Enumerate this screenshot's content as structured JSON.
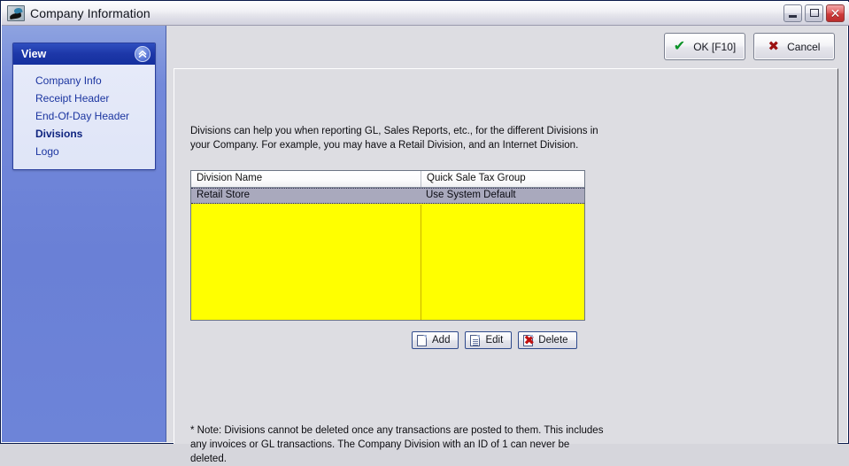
{
  "window": {
    "title": "Company Information",
    "icon": "app-swoosh-icon",
    "controls": {
      "minimize": "Minimize",
      "maximize": "Maximize",
      "close": "Close"
    }
  },
  "sidebar": {
    "header": {
      "title": "View",
      "collapse_icon": "chevron-double-up-icon"
    },
    "items": [
      {
        "label": "Company Info",
        "active": false
      },
      {
        "label": "Receipt Header",
        "active": false
      },
      {
        "label": "End-Of-Day Header",
        "active": false
      },
      {
        "label": "Divisions",
        "active": true
      },
      {
        "label": "Logo",
        "active": false
      }
    ]
  },
  "toolbar": {
    "ok_label": "OK [F10]",
    "ok_icon": "check-icon",
    "cancel_label": "Cancel",
    "cancel_icon": "x-icon"
  },
  "main": {
    "description": "Divisions can help you when reporting GL, Sales Reports, etc., for the different Divisions in your Company.  For example, you may have a Retail Division, and an Internet Division.",
    "grid": {
      "columns": [
        "Division Name",
        "Quick Sale Tax Group"
      ],
      "rows": [
        {
          "division_name": "Retail Store",
          "quick_sale_tax_group": "Use System Default",
          "selected": true
        }
      ],
      "empty_background_color": "#ffff00",
      "selected_row_color": "#a9a9bd"
    },
    "actions": [
      {
        "label": "Add",
        "icon": "new-page-icon"
      },
      {
        "label": "Edit",
        "icon": "edit-page-icon"
      },
      {
        "label": "Delete",
        "icon": "delete-page-icon"
      }
    ],
    "note": "* Note: Divisions cannot be deleted once any transactions are posted to them.  This includes any invoices or GL transactions.  The Company Division with an ID of 1 can never be deleted."
  },
  "colors": {
    "sidebar_blue": "#6a80d6",
    "sidebar_header_blue": "#1d37a8",
    "content_gray": "#dddde2",
    "grid_yellow": "#ffff00",
    "ok_green": "#0a9226",
    "cancel_red": "#9c1111"
  }
}
